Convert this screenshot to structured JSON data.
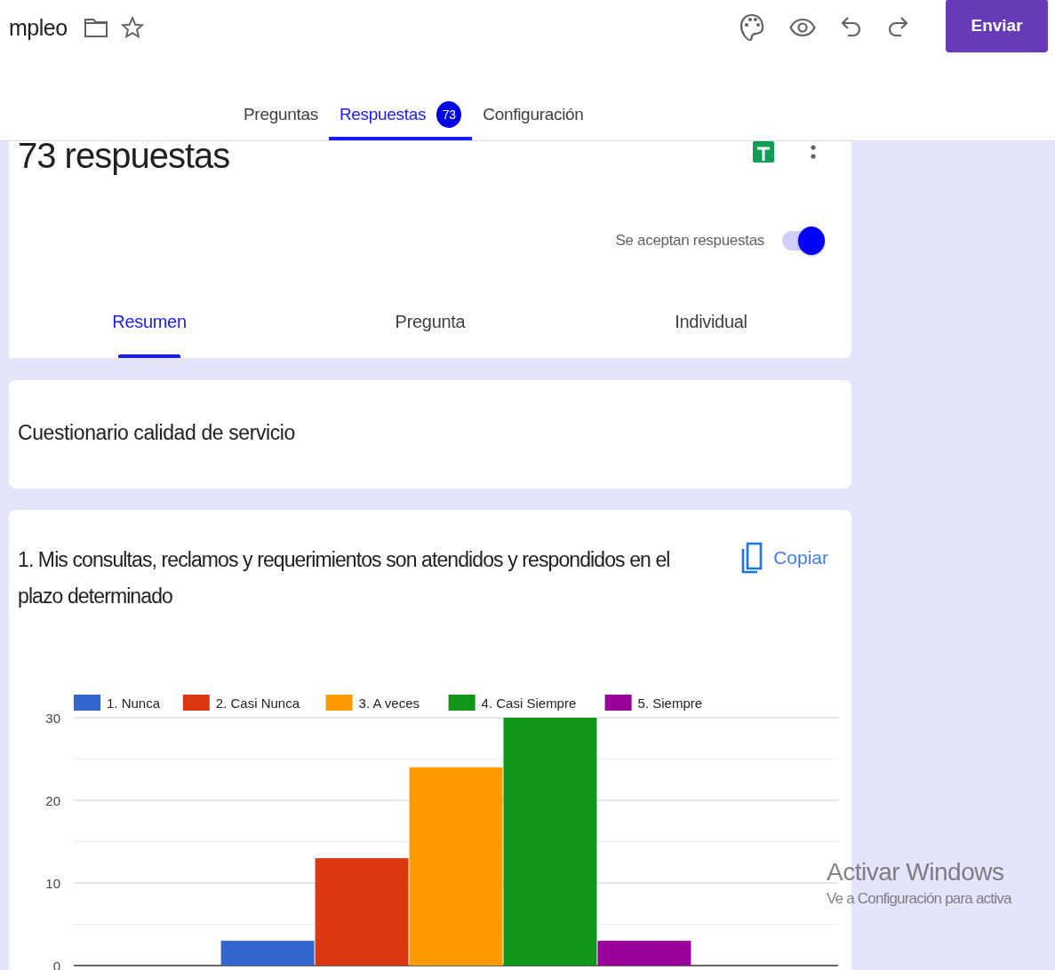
{
  "form": {
    "title": "mpleo"
  },
  "toolbar": {
    "send_button": "Enviar"
  },
  "tabs": [
    {
      "label": "Preguntas",
      "selected": false
    },
    {
      "label": "Respuestas",
      "selected": true,
      "badge": "73"
    },
    {
      "label": "Configuración",
      "selected": false
    }
  ],
  "summary": {
    "count_title": "73 respuestas",
    "accepting": {
      "label": "Se aceptan respuestas",
      "on": true
    }
  },
  "view_tabs": [
    {
      "label": "Resumen",
      "selected": true
    },
    {
      "label": "Pregunta",
      "selected": false
    },
    {
      "label": "Individual",
      "selected": false
    }
  ],
  "section": {
    "title": "Cuestionario calidad de servicio"
  },
  "question": {
    "title": "1. Mis consultas, reclamos y requerimientos son atendidos y respondidos en el plazo determinado",
    "copy_button": "Copiar",
    "chart_data": {
      "type": "bar",
      "legend": "top",
      "ylim": [
        0,
        30
      ],
      "yticks": [
        0,
        10,
        20,
        30
      ],
      "series": [
        {
          "name": "1. Nunca",
          "color": "#3366cc",
          "values": [
            3
          ]
        },
        {
          "name": "2. Casi Nunca",
          "color": "#dc3912",
          "values": [
            13
          ]
        },
        {
          "name": "3. A veces",
          "color": "#ff9900",
          "values": [
            24
          ]
        },
        {
          "name": "4. Casi Siempre",
          "color": "#109618",
          "values": [
            30
          ]
        },
        {
          "name": "5. Siempre",
          "color": "#990099",
          "values": [
            3
          ]
        }
      ]
    }
  },
  "os_watermark": {
    "title": "Activar Windows",
    "subtitle": "Ve a Configuración para activa"
  }
}
